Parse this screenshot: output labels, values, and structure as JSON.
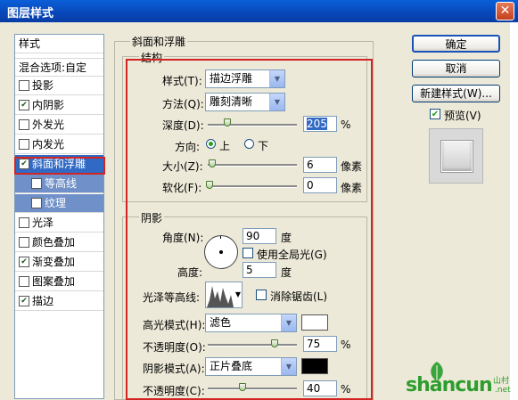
{
  "window": {
    "title": "图层样式",
    "close": "✕"
  },
  "sidebar": {
    "header": "样式",
    "blend_options": "混合选项:自定",
    "items": [
      {
        "label": "投影",
        "checked": false
      },
      {
        "label": "内阴影",
        "checked": true
      },
      {
        "label": "外发光",
        "checked": false
      },
      {
        "label": "内发光",
        "checked": false
      },
      {
        "label": "斜面和浮雕",
        "checked": true,
        "selected": true
      },
      {
        "label": "等高线",
        "checked": false,
        "sub": true
      },
      {
        "label": "纹理",
        "checked": false,
        "sub": true
      },
      {
        "label": "光泽",
        "checked": false
      },
      {
        "label": "颜色叠加",
        "checked": false
      },
      {
        "label": "渐变叠加",
        "checked": true
      },
      {
        "label": "图案叠加",
        "checked": false
      },
      {
        "label": "描边",
        "checked": true
      }
    ]
  },
  "bevel": {
    "group_title": "斜面和浮雕",
    "structure": {
      "title": "结构",
      "style_label": "样式(T):",
      "style_value": "描边浮雕",
      "technique_label": "方法(Q):",
      "technique_value": "雕刻清晰",
      "depth_label": "深度(D):",
      "depth_value": "205",
      "depth_unit": "%",
      "direction_label": "方向:",
      "direction_up": "上",
      "direction_down": "下",
      "size_label": "大小(Z):",
      "size_value": "6",
      "size_unit": "像素",
      "soften_label": "软化(F):",
      "soften_value": "0",
      "soften_unit": "像素"
    },
    "shading": {
      "title": "阴影",
      "angle_label": "角度(N):",
      "angle_value": "90",
      "angle_unit": "度",
      "global_light": "使用全局光(G)",
      "altitude_label": "高度:",
      "altitude_value": "5",
      "altitude_unit": "度",
      "gloss_label": "光泽等高线:",
      "antialias": "消除锯齿(L)",
      "highlight_mode_label": "高光模式(H):",
      "highlight_mode": "滤色",
      "highlight_opacity_label": "不透明度(O):",
      "highlight_opacity": "75",
      "shadow_mode_label": "阴影模式(A):",
      "shadow_mode": "正片叠底",
      "shadow_opacity_label": "不透明度(C):",
      "shadow_opacity": "40",
      "percent": "%"
    }
  },
  "buttons": {
    "ok": "确定",
    "cancel": "取消",
    "new_style": "新建样式(W)...",
    "preview": "预览(V)"
  },
  "watermark": {
    "brand": "shancun",
    "sub": "山村",
    "tld": ".net"
  }
}
